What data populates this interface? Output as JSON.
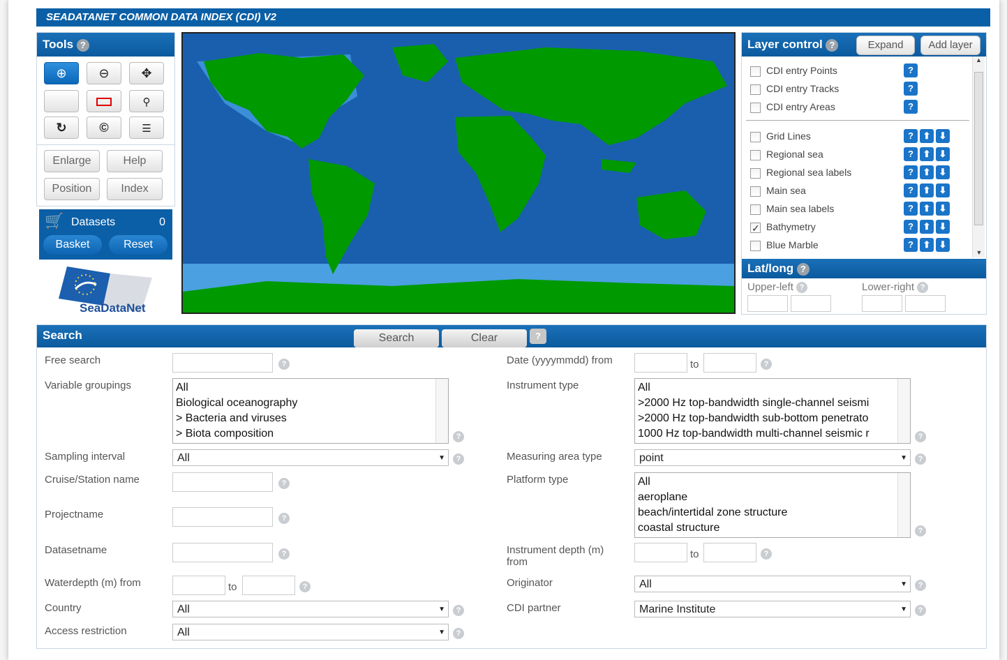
{
  "header": {
    "title": "SEADATANET COMMON DATA INDEX (CDI) V2"
  },
  "tools": {
    "title": "Tools",
    "help_glyph": "?",
    "enlarge": "Enlarge",
    "help": "Help",
    "position": "Position",
    "index": "Index"
  },
  "basket": {
    "title": "Datasets",
    "count": "0",
    "basket_btn": "Basket",
    "reset_btn": "Reset"
  },
  "logo": {
    "text": "SeaDataNet"
  },
  "layer_control": {
    "title": "Layer control",
    "expand": "Expand",
    "add_layer": "Add layer",
    "items": [
      {
        "label": "CDI entry Points",
        "checked": false
      },
      {
        "label": "CDI entry Tracks",
        "checked": false
      },
      {
        "label": "CDI entry Areas",
        "checked": false
      },
      {
        "label": "Grid Lines",
        "checked": false
      },
      {
        "label": "Regional sea",
        "checked": false
      },
      {
        "label": "Regional sea labels",
        "checked": false
      },
      {
        "label": "Main sea",
        "checked": false
      },
      {
        "label": "Main sea labels",
        "checked": false
      },
      {
        "label": "Bathymetry",
        "checked": true
      },
      {
        "label": "Blue Marble",
        "checked": false
      }
    ]
  },
  "latlong": {
    "title": "Lat/long",
    "upper_left": "Upper-left",
    "lower_right": "Lower-right"
  },
  "search": {
    "title": "Search",
    "search_btn": "Search",
    "clear_btn": "Clear",
    "free_search": "Free search",
    "variable_groupings": "Variable groupings",
    "variable_options": [
      "All",
      "Biological oceanography",
      "> Bacteria and viruses",
      "> Biota composition"
    ],
    "sampling_interval": "Sampling interval",
    "sampling_value": "All",
    "cruise_station": "Cruise/Station name",
    "projectname": "Projectname",
    "datasetname": "Datasetname",
    "waterdepth": "Waterdepth (m) from",
    "to": "to",
    "country": "Country",
    "country_value": "All",
    "access_restriction": "Access restriction",
    "access_value": "All",
    "date": "Date (yyyymmdd) from",
    "instrument_type": "Instrument type",
    "instrument_options": [
      "All",
      ">2000 Hz top-bandwidth single-channel seismi",
      ">2000 Hz top-bandwidth sub-bottom penetrato",
      "1000 Hz top-bandwidth multi-channel seismic r"
    ],
    "measuring_area_type": "Measuring area type",
    "measuring_value": "point",
    "platform_type": "Platform type",
    "platform_options": [
      "All",
      "aeroplane",
      "beach/intertidal zone structure",
      "coastal structure"
    ],
    "instrument_depth": "Instrument depth (m)",
    "instrument_depth_from": "from",
    "originator": "Originator",
    "originator_value": "All",
    "cdi_partner": "CDI partner",
    "cdi_partner_value": "Marine Institute"
  }
}
